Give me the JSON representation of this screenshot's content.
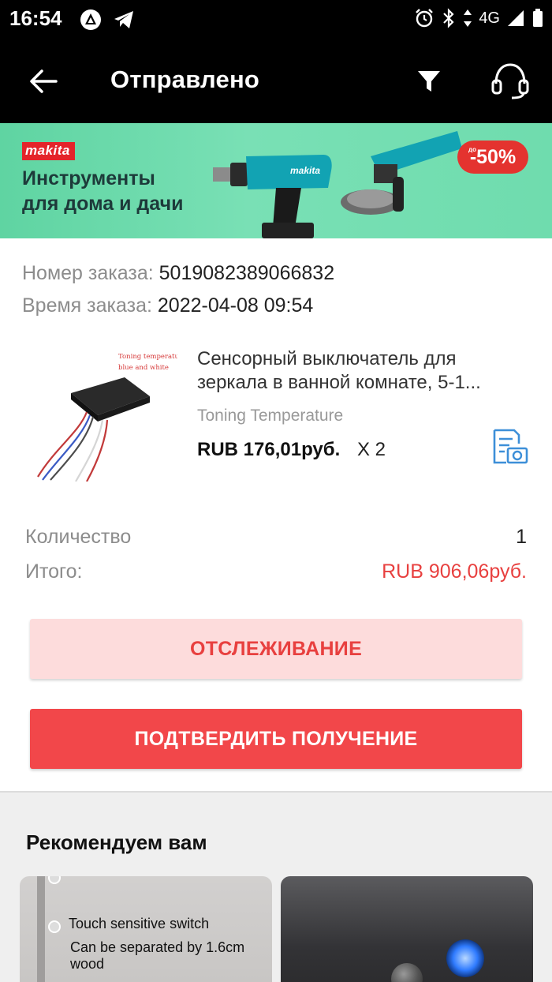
{
  "status_bar": {
    "time": "16:54",
    "network": "4G",
    "icons": [
      "notification-icon",
      "telegram-icon",
      "alarm-icon",
      "bluetooth-icon",
      "signal-icon",
      "battery-icon"
    ]
  },
  "app_bar": {
    "title": "Отправлено",
    "icons": [
      "back-arrow-icon",
      "filter-icon",
      "headset-icon"
    ]
  },
  "banner": {
    "brand": "makita",
    "line1": "Инструменты",
    "line2": "для дома и дачи",
    "discount_prefix": "до",
    "discount": "-50%"
  },
  "order": {
    "number_label": "Номер заказа:",
    "number": "5019082389066832",
    "time_label": "Время заказа:",
    "time": "2022-04-08 09:54"
  },
  "product": {
    "image_caption1": "Toning temperature",
    "image_caption2": "blue and white",
    "title": "Сенсорный выключатель для зеркала в ванной комнате, 5-1...",
    "variant": "Toning Temperature",
    "price": "RUB 176,01руб.",
    "quantity": "X 2"
  },
  "summary": {
    "quantity_label": "Количество",
    "quantity_value": "1",
    "total_label": "Итого:",
    "total_value": "RUB 906,06руб."
  },
  "actions": {
    "track_label": "ОТСЛЕЖИВАНИЕ",
    "confirm_label": "ПОДТВЕРДИТЬ ПОЛУЧЕНИЕ"
  },
  "recommendations": {
    "title": "Рекомендуем вам",
    "card1_line1": "Touch sensitive switch",
    "card1_line2": "Can be separated by 1.6cm wood"
  },
  "colors": {
    "accent_red": "#f2474a",
    "total_red": "#e8403f",
    "track_bg": "#fddcdc",
    "icon_blue": "#3d8fd8",
    "banner_green": "#6fdcae"
  }
}
